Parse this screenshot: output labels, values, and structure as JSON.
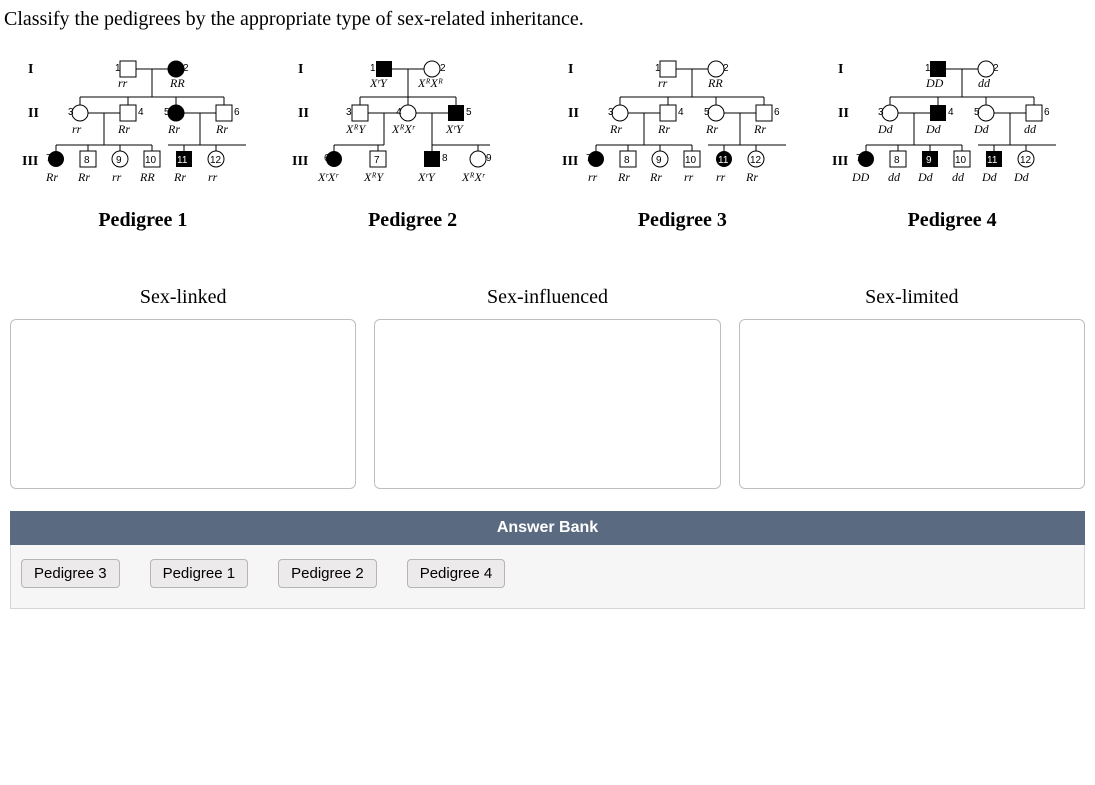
{
  "question": "Classify the pedigrees by the appropriate type of sex-related inheritance.",
  "pedigrees": [
    {
      "caption": "Pedigree 1",
      "gen1": {
        "g1": "rr",
        "g2": "RR"
      },
      "gen2": {
        "n": [
          "3",
          "4",
          "5",
          "6"
        ],
        "g": [
          "rr",
          "Rr",
          "Rr",
          "Rr"
        ]
      },
      "gen3": {
        "n": [
          "7",
          "8",
          "9",
          "10",
          "11",
          "12"
        ],
        "g": [
          "Rr",
          "Rr",
          "rr",
          "RR",
          "Rr",
          "rr"
        ]
      }
    },
    {
      "caption": "Pedigree 2",
      "gen1": {
        "g1": "XʳY",
        "g2": "XᴿXᴿ"
      },
      "gen2": {
        "n": [
          "3",
          "4",
          "5"
        ],
        "g": [
          "XᴿY",
          "XᴿXʳ",
          "XʳY"
        ]
      },
      "gen3": {
        "n": [
          "6",
          "7",
          "8",
          "9"
        ],
        "g": [
          "XʳXʳ",
          "XᴿY",
          "XʳY",
          "XᴿXʳ"
        ]
      }
    },
    {
      "caption": "Pedigree 3",
      "gen1": {
        "g1": "rr",
        "g2": "RR"
      },
      "gen2": {
        "n": [
          "3",
          "4",
          "5",
          "6"
        ],
        "g": [
          "Rr",
          "Rr",
          "Rr",
          "Rr"
        ]
      },
      "gen3": {
        "n": [
          "7",
          "8",
          "9",
          "10",
          "11",
          "12"
        ],
        "g": [
          "rr",
          "Rr",
          "Rr",
          "rr",
          "rr",
          "Rr"
        ]
      }
    },
    {
      "caption": "Pedigree 4",
      "gen1": {
        "g1": "DD",
        "g2": "dd"
      },
      "gen2": {
        "n": [
          "3",
          "4",
          "5",
          "6"
        ],
        "g": [
          "Dd",
          "Dd",
          "Dd",
          "dd"
        ]
      },
      "gen3": {
        "n": [
          "7",
          "8",
          "9",
          "10",
          "11",
          "12"
        ],
        "g": [
          "DD",
          "dd",
          "Dd",
          "dd",
          "Dd",
          "Dd"
        ]
      }
    }
  ],
  "drop_labels": [
    "Sex-linked",
    "Sex-influenced",
    "Sex-limited"
  ],
  "answer_bank_title": "Answer Bank",
  "chips": [
    "Pedigree 3",
    "Pedigree 1",
    "Pedigree 2",
    "Pedigree 4"
  ]
}
